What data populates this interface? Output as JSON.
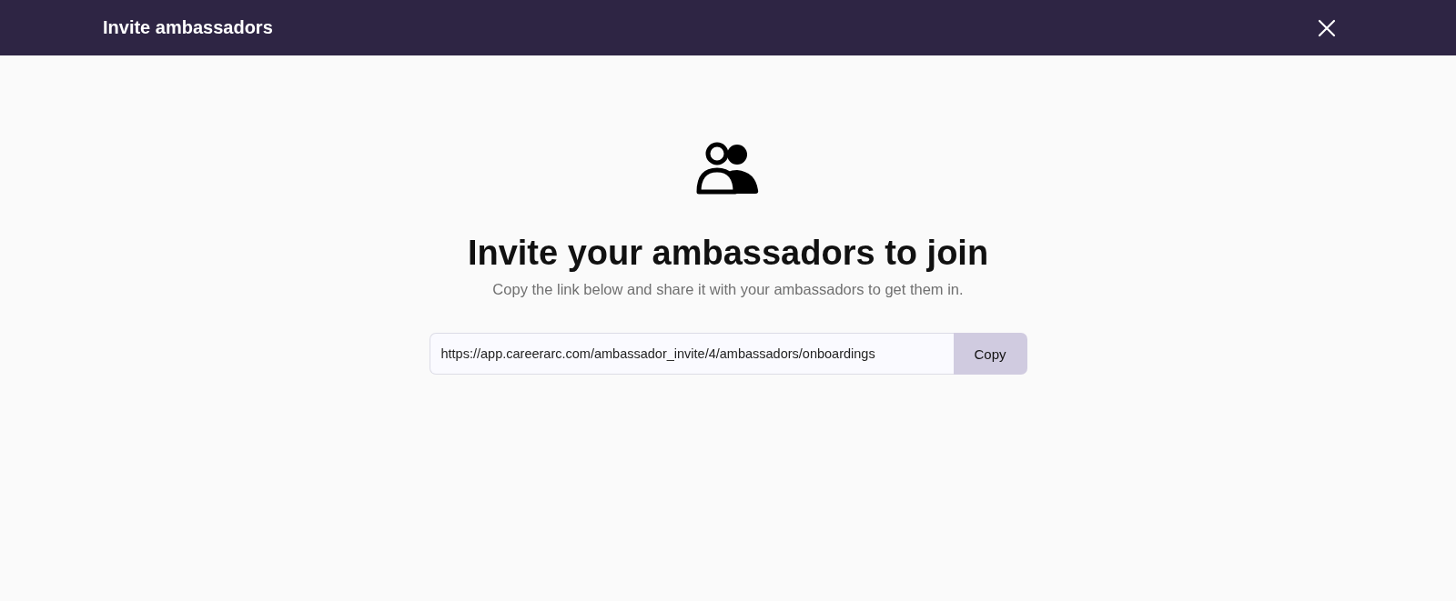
{
  "header": {
    "title": "Invite ambassadors"
  },
  "heading": "Invite your ambassadors to join",
  "subtitle": "Copy the link below and share it with your ambassadors to get them in.",
  "link_field": {
    "value": "https://app.careerarc.com/ambassador_invite/4/ambassadors/onboardings"
  },
  "copy_button": "Copy"
}
